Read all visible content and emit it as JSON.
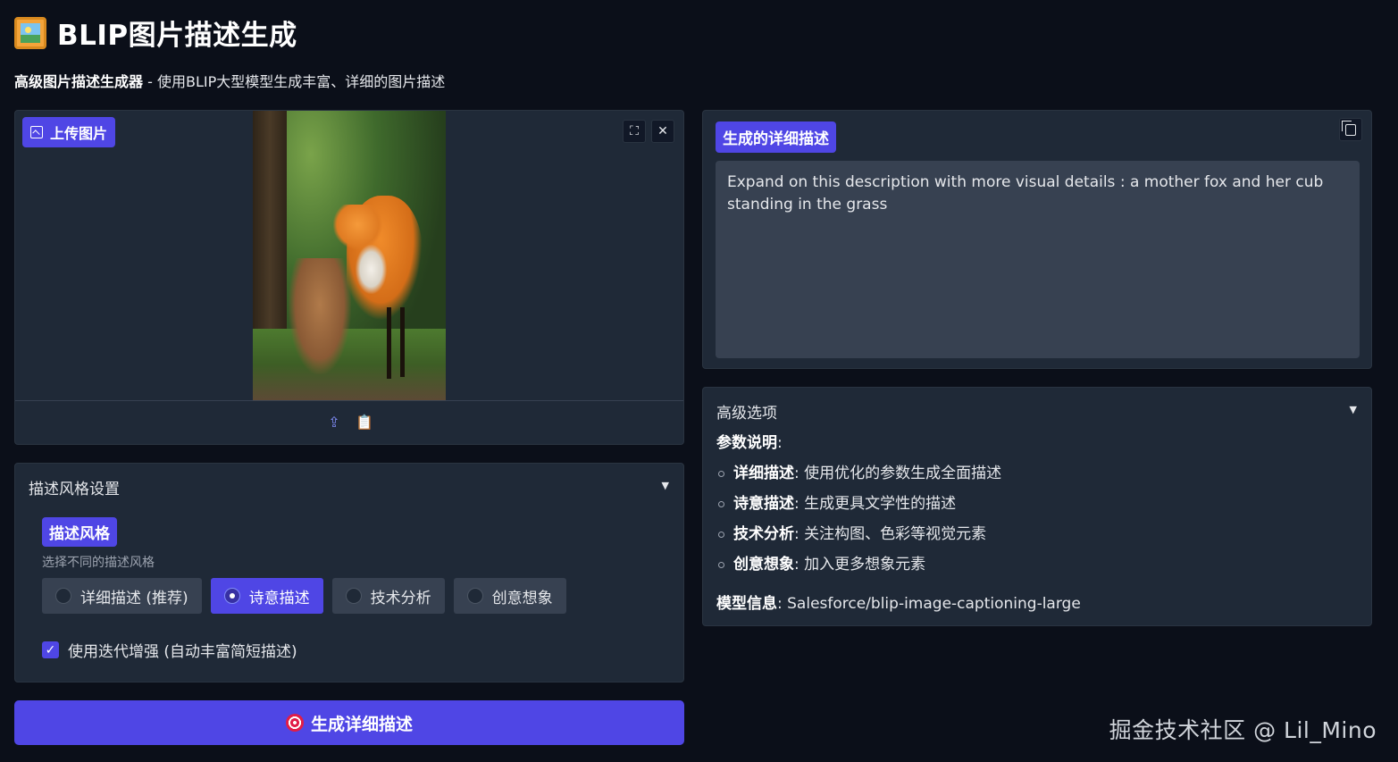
{
  "header": {
    "title": "BLIP图片描述生成",
    "subtitle_bold": "高级图片描述生成器",
    "subtitle_rest": " - 使用BLIP大型模型生成丰富、详细的图片描述"
  },
  "upload": {
    "tag_label": "上传图片",
    "fullscreen_glyph": "⛶",
    "close_glyph": "✕",
    "upload_glyph": "⇪",
    "clipboard_glyph": "📋"
  },
  "style_settings": {
    "title": "描述风格设置",
    "arrow": "▼",
    "tag_label": "描述风格",
    "hint": "选择不同的描述风格",
    "options": [
      {
        "label": "详细描述 (推荐)",
        "selected": false
      },
      {
        "label": "诗意描述",
        "selected": true
      },
      {
        "label": "技术分析",
        "selected": false
      },
      {
        "label": "创意想象",
        "selected": false
      }
    ],
    "checkbox_label": "使用迭代增强 (自动丰富简短描述)",
    "checkbox_checked": true
  },
  "generate_button": {
    "label": "生成详细描述"
  },
  "output": {
    "tag_label": "生成的详细描述",
    "text": "Expand on this description with more visual details : a mother fox and her cub standing in the grass"
  },
  "advanced": {
    "title": "高级选项",
    "arrow": "▼",
    "params_heading": "参数说明",
    "params_colon": ":",
    "items": [
      {
        "name": "详细描述",
        "desc": ": 使用优化的参数生成全面描述"
      },
      {
        "name": "诗意描述",
        "desc": ": 生成更具文学性的描述"
      },
      {
        "name": "技术分析",
        "desc": ": 关注构图、色彩等视觉元素"
      },
      {
        "name": "创意想象",
        "desc": ": 加入更多想象元素"
      }
    ],
    "model_label": "模型信息",
    "model_value": ": Salesforce/blip-image-captioning-large"
  },
  "watermark": "掘金技术社区 @ Lil_Mino",
  "colors": {
    "accent": "#4f46e5",
    "background": "#0b0f19",
    "panel": "#1f2937"
  }
}
